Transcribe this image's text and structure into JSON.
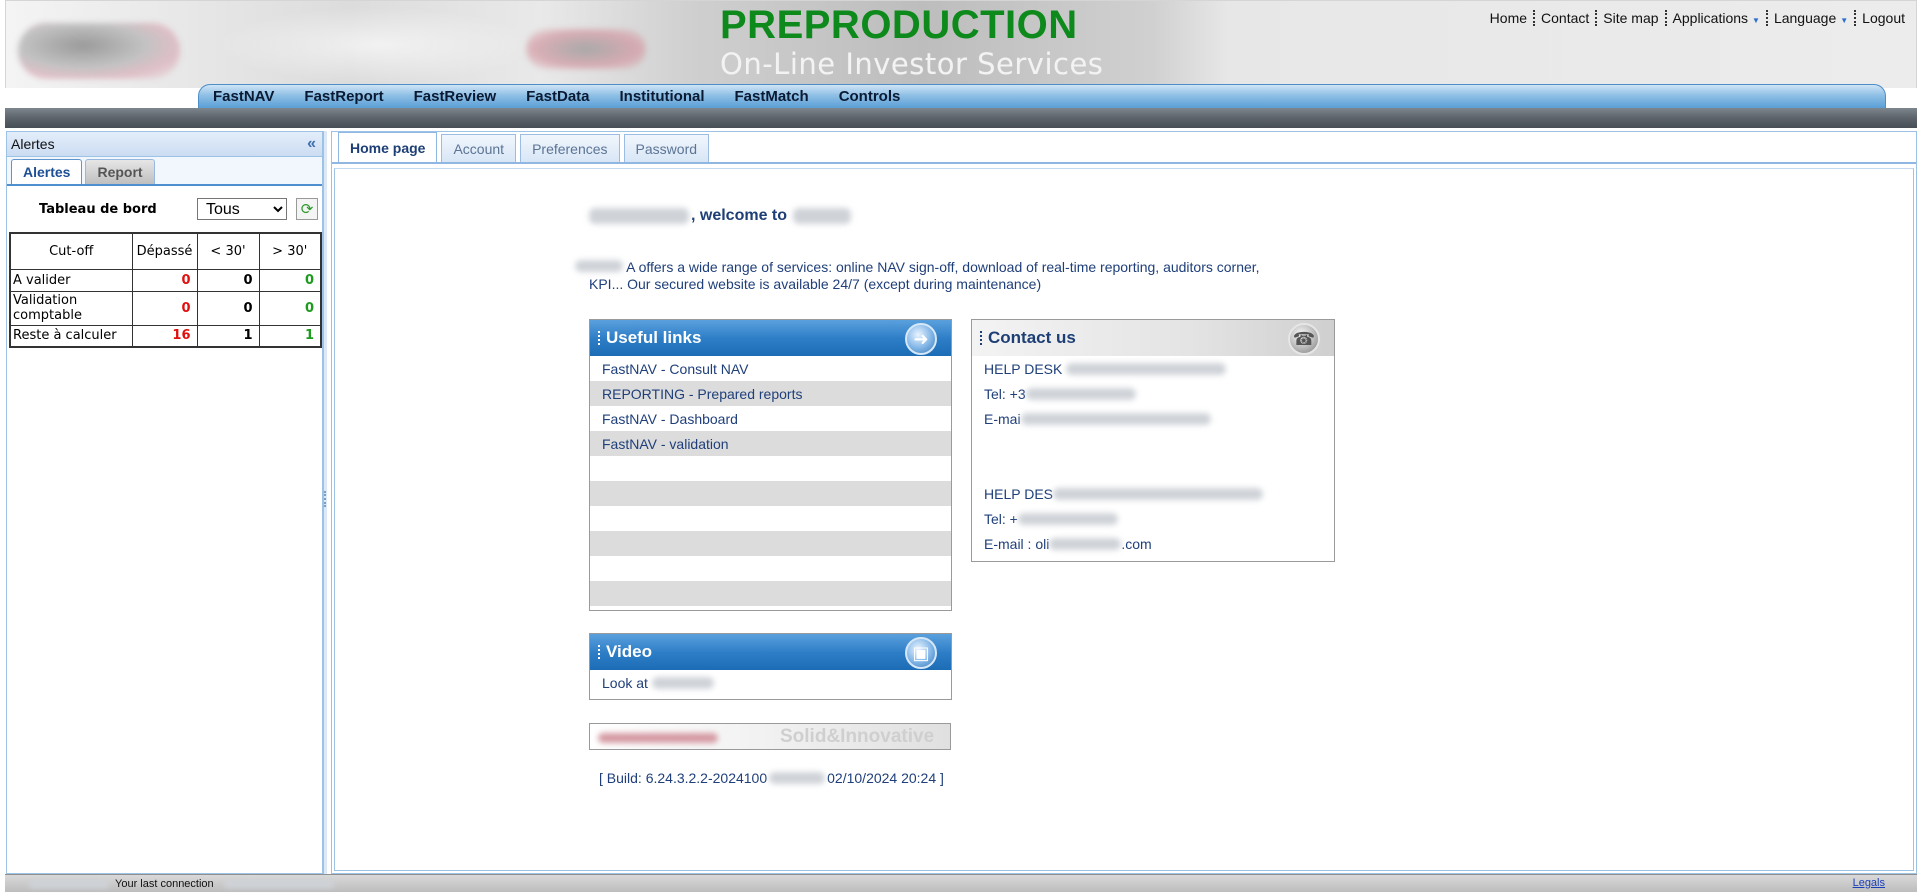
{
  "header": {
    "title": "PREPRODUCTION",
    "subtitle": "On-Line Investor Services",
    "top_links": [
      "Home",
      "Contact",
      "Site map",
      "Applications",
      "Language",
      "Logout"
    ],
    "nav": [
      "FastNAV",
      "FastReport",
      "FastReview",
      "FastData",
      "Institutional",
      "FastMatch",
      "Controls"
    ]
  },
  "sidebar": {
    "title": "Alertes",
    "tabs": [
      "Alertes",
      "Report"
    ],
    "dashboard_label": "Tableau de bord",
    "dashboard_select": "Tous",
    "table": {
      "headers": [
        "Cut-off",
        "Dépassé",
        "< 30'",
        "> 30'"
      ],
      "rows": [
        {
          "label": "A valider",
          "depasse": "0",
          "lt30": "0",
          "gt30": "0"
        },
        {
          "label": "Validation comptable",
          "depasse": "0",
          "lt30": "0",
          "gt30": "0"
        },
        {
          "label": "Reste à calculer",
          "depasse": "16",
          "lt30": "1",
          "gt30": "1"
        }
      ]
    }
  },
  "main": {
    "tabs": [
      "Home page",
      "Account",
      "Preferences",
      "Password"
    ],
    "welcome_mid": ", welcome to",
    "intro_part1": "A offers a wide range of services: online NAV sign-off, download of real-time reporting, auditors corner,",
    "intro_part2": "KPI... Our secured website is available 24/7 (except during maintenance)",
    "useful_links": {
      "title": "Useful links",
      "items": [
        "FastNAV - Consult NAV",
        "REPORTING - Prepared reports",
        "FastNAV - Dashboard",
        "FastNAV - validation"
      ]
    },
    "contact": {
      "title": "Contact us",
      "line1": "HELP DESK",
      "line2": "Tel: +3",
      "line3": "E-mai",
      "line4": "HELP DES",
      "line5": "Tel: +",
      "line6": "E-mail : oli",
      "line6_end": ".com"
    },
    "video": {
      "title": "Video",
      "text": "Look at"
    },
    "banner_slogan": "Solid&Innovative",
    "build_prefix": "[ Build: 6.24.3.2.2-2024100",
    "build_suffix": "02/10/2024 20:24 ]"
  },
  "footer": {
    "last_connection": "Your last connection",
    "legals": "Legals"
  }
}
